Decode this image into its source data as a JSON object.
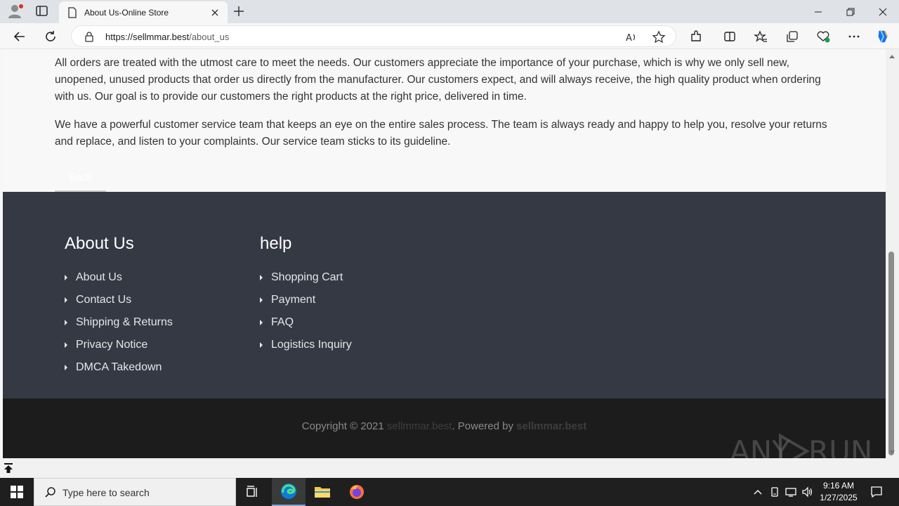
{
  "browser": {
    "tab_title": "About Us-Online Store",
    "url_host": "https://sellmmar.best",
    "url_path": "/about_us"
  },
  "content": {
    "paragraph_1": "All orders are treated with the utmost care to meet the needs. Our customers appreciate the importance of your purchase, which is why we only sell new, unopened, unused products that order us directly from the manufacturer. Our customers expect, and will always receive, the high quality product when ordering with us. Our goal is to provide our customers the right products at the right price, delivered in time.",
    "paragraph_2": "We have a powerful customer service team that keeps an eye on the entire sales process. The team is always ready and happy to help you, resolve your returns and replace, and listen to your complaints. Our service team sticks to its guideline.",
    "back_label": "Back"
  },
  "footer": {
    "about": {
      "heading": "About Us",
      "links": [
        "About Us",
        "Contact Us",
        "Shipping & Returns",
        "Privacy Notice",
        "DMCA Takedown"
      ]
    },
    "help": {
      "heading": "help",
      "links": [
        "Shopping Cart",
        "Payment",
        "FAQ",
        "Logistics Inquiry"
      ]
    },
    "copyright_prefix": "Copyright © 2021 ",
    "copyright_site": "sellmmar.best",
    "copyright_middle": ". Powered by ",
    "copyright_powered": "sellmmar.best"
  },
  "watermark": "ANY RUN",
  "taskbar": {
    "search_placeholder": "Type here to search",
    "time": "9:16 AM",
    "date": "1/27/2025"
  },
  "colors": {
    "footer_top": "#343944",
    "footer_bottom": "#1c1c1c",
    "edge_accent": "#1a73e8"
  }
}
